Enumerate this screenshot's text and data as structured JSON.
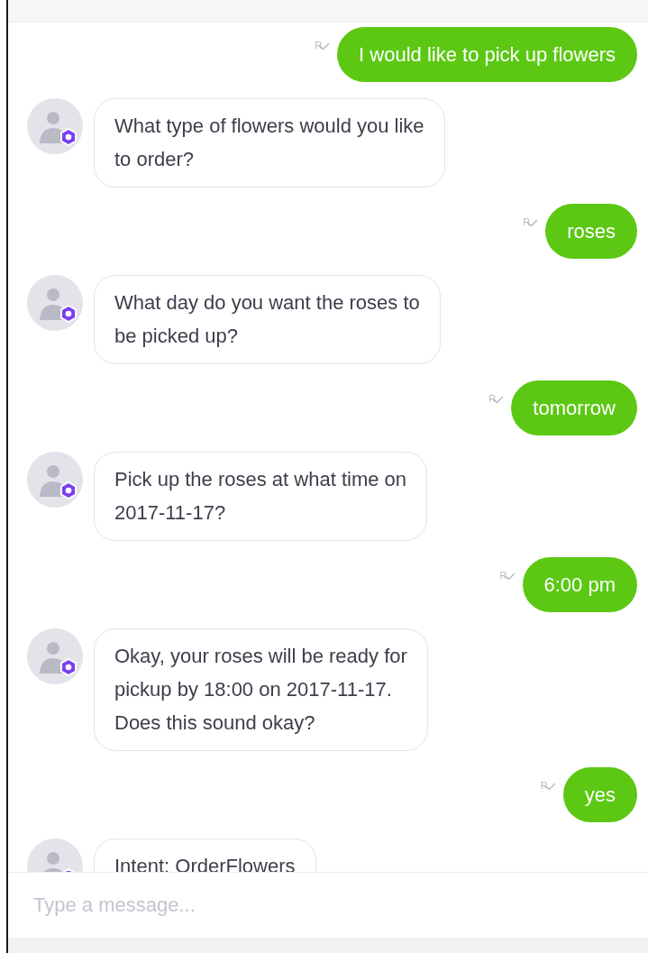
{
  "messages": [
    {
      "kind": "user",
      "lines": [
        "I would like to pick up flowers"
      ],
      "receipt": "R"
    },
    {
      "kind": "bot",
      "lines": [
        "What type of flowers would you like",
        "to order?"
      ]
    },
    {
      "kind": "user",
      "lines": [
        "roses"
      ],
      "receipt": "R"
    },
    {
      "kind": "bot",
      "lines": [
        "What day do you want the roses to",
        "be picked up?"
      ]
    },
    {
      "kind": "user",
      "lines": [
        "tomorrow"
      ],
      "receipt": "R"
    },
    {
      "kind": "bot",
      "lines": [
        "Pick up the roses at what time on",
        "2017-11-17?"
      ]
    },
    {
      "kind": "user",
      "lines": [
        "6:00 pm"
      ],
      "receipt": "R"
    },
    {
      "kind": "bot",
      "lines": [
        "Okay, your roses will be ready for",
        "pickup by 18:00 on 2017-11-17.",
        "Does this sound okay?"
      ]
    },
    {
      "kind": "user",
      "lines": [
        "yes"
      ],
      "receipt": "R"
    },
    {
      "kind": "bot",
      "lines": [
        "Intent: OrderFlowers"
      ]
    }
  ],
  "composer": {
    "placeholder": "Type a message..."
  }
}
